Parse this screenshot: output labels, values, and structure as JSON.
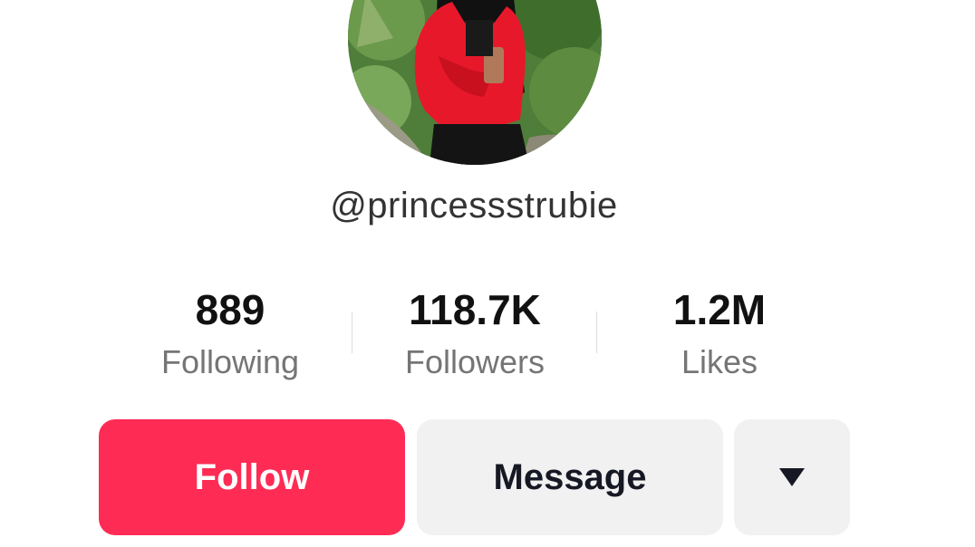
{
  "profile": {
    "username": "@princessstrubie"
  },
  "stats": {
    "following": {
      "value": "889",
      "label": "Following"
    },
    "followers": {
      "value": "118.7K",
      "label": "Followers"
    },
    "likes": {
      "value": "1.2M",
      "label": "Likes"
    }
  },
  "actions": {
    "follow_label": "Follow",
    "message_label": "Message",
    "more_icon": "caret-down-icon"
  },
  "colors": {
    "accent": "#fe2c55",
    "button_secondary": "#f1f1f2",
    "text_primary": "#111111",
    "text_secondary": "#757575"
  }
}
